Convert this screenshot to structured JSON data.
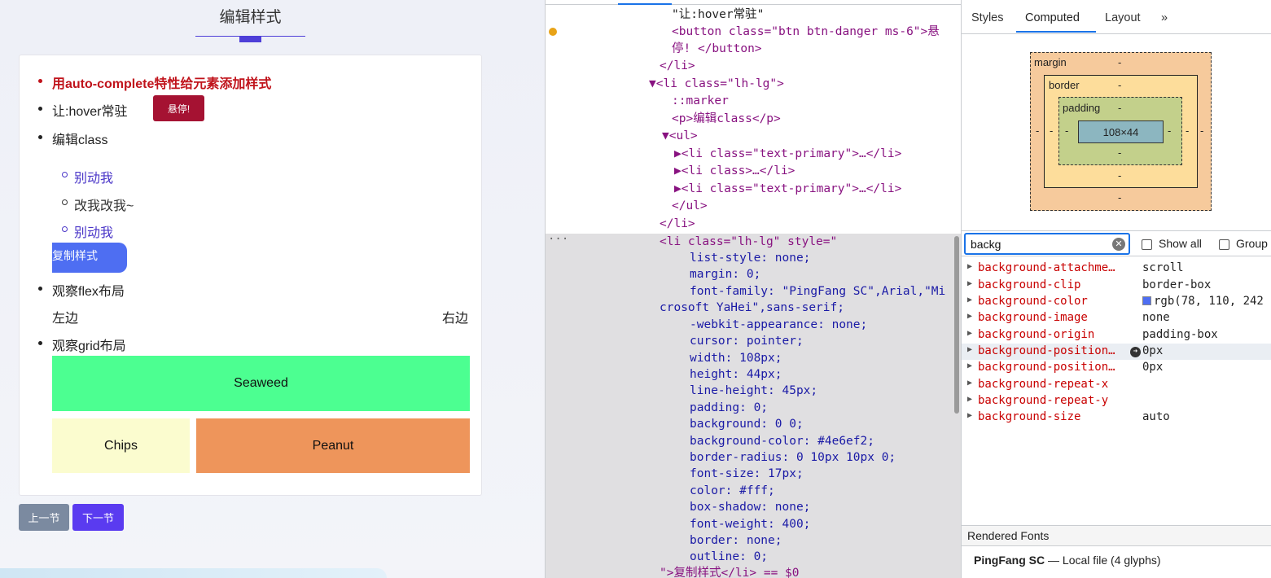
{
  "page": {
    "title": "编辑样式",
    "items": [
      {
        "label": "用auto-complete特性给元素添加样式"
      },
      {
        "label": "让:hover常驻",
        "button": "悬停!"
      },
      {
        "label": "编辑class",
        "sub": [
          {
            "label": "别动我"
          },
          {
            "label": "改我改我~"
          },
          {
            "label": "别动我"
          }
        ]
      },
      {
        "label": "观察flex布局",
        "left": "左边",
        "right": "右边"
      },
      {
        "label": "观察grid布局",
        "cells": [
          "Seaweed",
          "Chips",
          "Peanut"
        ]
      }
    ],
    "copy_button": "复制样式",
    "prev": "上一节",
    "next": "下一节"
  },
  "elements": {
    "lines": [
      "\"让:hover常驻\"",
      "<button class=\"btn btn-danger ms-6\">悬",
      "停! </button>",
      "</li>",
      "▼<li class=\"lh-lg\">",
      "::marker",
      "<p>编辑class</p>",
      "▼<ul>",
      "▶<li class=\"text-primary\">…</li>",
      "▶<li class>…</li>",
      "▶<li class=\"text-primary\">…</li>",
      "</ul>",
      "</li>",
      "<li class=\"lh-lg\" style=\"",
      "list-style: none;",
      "margin: 0;",
      "font-family: \"PingFang SC\",Arial,\"Mi",
      "crosoft YaHei\",sans-serif;",
      "-webkit-appearance: none;",
      "cursor: pointer;",
      "width: 108px;",
      "height: 44px;",
      "line-height: 45px;",
      "padding: 0;",
      "background: 0 0;",
      "background-color: #4e6ef2;",
      "border-radius: 0 10px 10px 0;",
      "font-size: 17px;",
      "color: #fff;",
      "box-shadow: none;",
      "font-weight: 400;",
      "border: none;",
      "outline: 0;",
      "\">复制样式</li> == $0"
    ],
    "ellipsis": "···"
  },
  "styles": {
    "tabs": [
      "Styles",
      "Computed",
      "Layout",
      "»"
    ],
    "box_model": {
      "margin": "margin",
      "border": "border",
      "padding": "padding",
      "content": "108×44",
      "dash": "-"
    },
    "filter": {
      "value": "backg",
      "show_all": "Show all",
      "group": "Group"
    },
    "properties": [
      {
        "name": "background-attachme…",
        "value": "scroll"
      },
      {
        "name": "background-clip",
        "value": "border-box"
      },
      {
        "name": "background-color",
        "value": "rgb(78, 110, 242"
      },
      {
        "name": "background-image",
        "value": "none"
      },
      {
        "name": "background-origin",
        "value": "padding-box"
      },
      {
        "name": "background-position…",
        "value": "0px"
      },
      {
        "name": "background-position…",
        "value": "0px"
      },
      {
        "name": "background-repeat-x",
        "value": ""
      },
      {
        "name": "background-repeat-y",
        "value": ""
      },
      {
        "name": "background-size",
        "value": "auto"
      }
    ],
    "rendered_fonts": {
      "title": "Rendered Fonts",
      "font": "PingFang SC",
      "sep": "—",
      "detail": "Local file (4 glyphs)"
    },
    "colors": {
      "swatch": "#4e6ef2",
      "accent": "#1a73e8"
    }
  }
}
